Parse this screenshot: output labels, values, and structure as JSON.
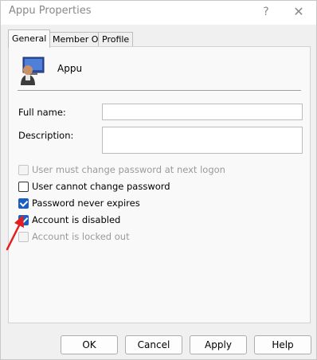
{
  "window": {
    "title": "Appu Properties",
    "help_glyph": "?",
    "close_glyph": "✕"
  },
  "tabs": [
    {
      "label": "General",
      "active": true
    },
    {
      "label": "Member Of",
      "active": false
    },
    {
      "label": "Profile",
      "active": false
    }
  ],
  "user": {
    "icon": "user-computer-icon",
    "name": "Appu"
  },
  "fields": {
    "full_name_label": "Full name:",
    "full_name_value": "",
    "description_label": "Description:",
    "description_value": ""
  },
  "options": [
    {
      "label": "User must change password at next logon",
      "checked": false,
      "enabled": false
    },
    {
      "label": "User cannot change password",
      "checked": false,
      "enabled": true
    },
    {
      "label": "Password never expires",
      "checked": true,
      "enabled": true
    },
    {
      "label": "Account is disabled",
      "checked": true,
      "enabled": true
    },
    {
      "label": "Account is locked out",
      "checked": false,
      "enabled": false
    }
  ],
  "annotation": {
    "icon": "red-arrow-icon",
    "color": "#e02020"
  },
  "buttons": {
    "ok": "OK",
    "cancel": "Cancel",
    "apply": "Apply",
    "help": "Help"
  },
  "colors": {
    "accent": "#1a5fbf",
    "disabled_text": "#9a9a9a"
  }
}
